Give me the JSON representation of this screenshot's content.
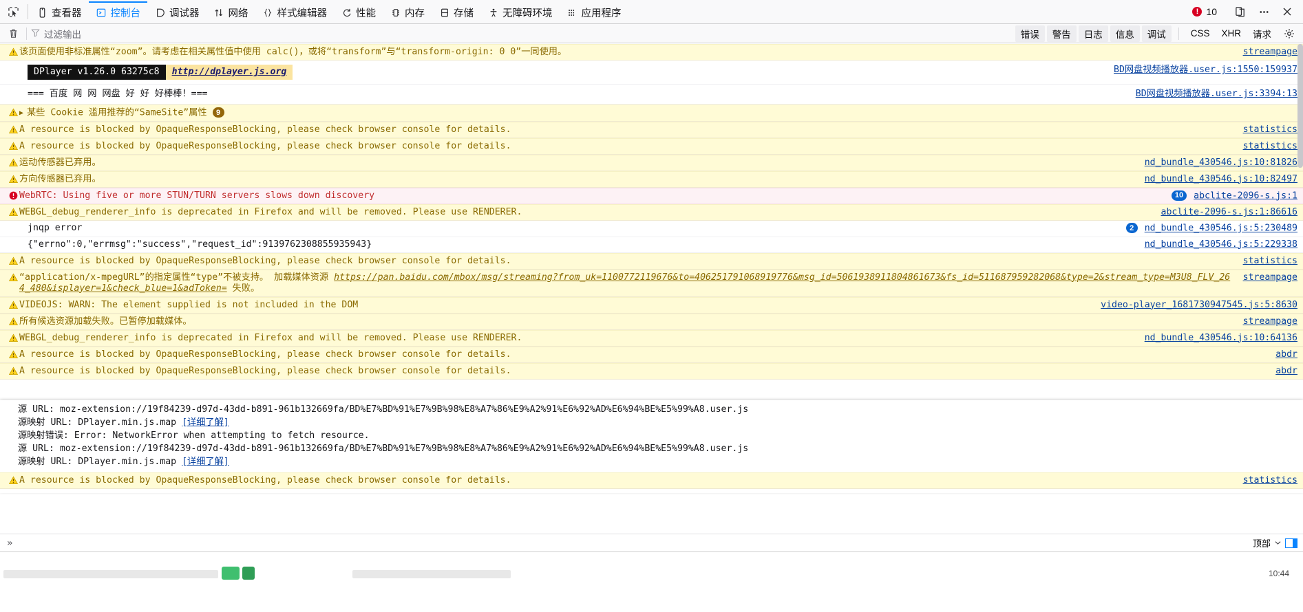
{
  "toolbar": {
    "picker_icon": "element-picker-icon",
    "tabs": [
      {
        "label": "查看器",
        "icon": "inspector-icon",
        "active": false
      },
      {
        "label": "控制台",
        "icon": "console-icon",
        "active": true
      },
      {
        "label": "调试器",
        "icon": "debugger-icon",
        "active": false
      },
      {
        "label": "网络",
        "icon": "network-icon",
        "active": false
      },
      {
        "label": "样式编辑器",
        "icon": "style-editor-icon",
        "active": false
      },
      {
        "label": "性能",
        "icon": "performance-icon",
        "active": false
      },
      {
        "label": "内存",
        "icon": "memory-icon",
        "active": false
      },
      {
        "label": "存储",
        "icon": "storage-icon",
        "active": false
      },
      {
        "label": "无障碍环境",
        "icon": "accessibility-icon",
        "active": false
      },
      {
        "label": "应用程序",
        "icon": "application-icon",
        "active": false
      }
    ],
    "error_count": "10",
    "responsive_icon": "responsive-design-mode-icon",
    "meatball_icon": "more-options-icon",
    "close_icon": "close-icon"
  },
  "filter_bar": {
    "trash_icon": "trash-icon",
    "funnel_icon": "funnel-icon",
    "filter_placeholder": "过滤输出",
    "filter_value": "",
    "levels": [
      "错误",
      "警告",
      "日志",
      "信息",
      "调试"
    ],
    "filters": [
      "CSS",
      "XHR",
      "请求"
    ],
    "settings_icon": "gear-icon"
  },
  "console": {
    "rows": [
      {
        "type": "warn",
        "text": "该页面使用非标准属性“zoom”。请考虑在相关属性值中使用 calc()，或将“transform”与“transform-origin: 0 0”一同使用。",
        "source": "streampage"
      },
      {
        "type": "dplayer",
        "badge_dark": "DPlayer v1.26.0 63275c8",
        "badge_link": "http://dplayer.js.org",
        "source": "BD网盘视频播放器.user.js:1550:159937"
      },
      {
        "type": "log",
        "text": "=== 百度 网 网 网盘 好 好 好棒棒！===",
        "source": "BD网盘视频播放器.user.js:3394:13"
      },
      {
        "type": "warn",
        "expandable": true,
        "text": "某些 Cookie 滥用推荐的“SameSite”属性",
        "badge": "9",
        "badge_style": "warn",
        "source": ""
      },
      {
        "type": "warn",
        "text": "A resource is blocked by OpaqueResponseBlocking, please check browser console for details.",
        "source": "statistics"
      },
      {
        "type": "warn",
        "text": "A resource is blocked by OpaqueResponseBlocking, please check browser console for details.",
        "source": "statistics"
      },
      {
        "type": "warn",
        "text": "运动传感器已弃用。",
        "source": "nd_bundle_430546.js:10:81826"
      },
      {
        "type": "warn",
        "text": "方向传感器已弃用。",
        "source": "nd_bundle_430546.js:10:82497"
      },
      {
        "type": "error",
        "text": "WebRTC: Using five or more STUN/TURN servers slows down discovery",
        "badge": "10",
        "badge_style": "blue",
        "source": "abclite-2096-s.js:1"
      },
      {
        "type": "warn",
        "text": "WEBGL_debug_renderer_info is deprecated in Firefox and will be removed. Please use RENDERER.",
        "source": "abclite-2096-s.js:1:86616"
      },
      {
        "type": "plain",
        "text": "jnqp error",
        "badge": "2",
        "badge_style": "blue",
        "source": "nd_bundle_430546.js:5:230489"
      },
      {
        "type": "plain",
        "text": "{\"errno\":0,\"errmsg\":\"success\",\"request_id\":9139762308855935943}",
        "source": "nd_bundle_430546.js:5:229338"
      },
      {
        "type": "warn",
        "text": "A resource is blocked by OpaqueResponseBlocking, please check browser console for details.",
        "source": "statistics"
      },
      {
        "type": "warn-link",
        "prefix": "“application/x-mpegURL”的指定属性“type”不被支持。 加载媒体资源 ",
        "link": "https://pan.baidu.com/mbox/msg/streaming?from_uk=1100772119676&to=406251791068919776&msg_id=5061938911804861673&fs_id=51168795928206​8&type=2&stream_type=M3U8_FLV_264_480&isplayer=1&check_blue=1&adToken=",
        "suffix": " 失败。",
        "source": "streampage"
      },
      {
        "type": "warn",
        "text": "VIDEOJS: WARN: The element supplied is not included in the DOM",
        "source": "video-player_1681730947545.js:5:8630"
      },
      {
        "type": "warn",
        "text": "所有候选资源加载失败。已暂停加载媒体。",
        "source": "streampage"
      },
      {
        "type": "warn",
        "text": "WEBGL_debug_renderer_info is deprecated in Firefox and will be removed. Please use RENDERER.",
        "source": "nd_bundle_430546.js:10:64136"
      },
      {
        "type": "warn",
        "text": "A resource is blocked by OpaqueResponseBlocking, please check browser console for details.",
        "source": "abdr"
      },
      {
        "type": "warn",
        "text": "A resource is blocked by OpaqueResponseBlocking, please check browser console for details.",
        "source": "abdr"
      }
    ],
    "sourcemap_panel": {
      "lines": [
        {
          "text": "源 URL: moz-extension://19f84239-d97d-43dd-b891-961b132669fa/BD%E7%BD%91%E7%9B%98%E8%A7%86%E9%A2%91%E6%92%AD%E6%94%BE%E5%99%A8.user.js",
          "link": ""
        },
        {
          "text": "源映射 URL: DPlayer.min.js.map",
          "link": "[详细了解]"
        },
        {
          "text": "源映射错误: Error: NetworkError when attempting to fetch resource.",
          "link": ""
        },
        {
          "text": "源 URL: moz-extension://19f84239-d97d-43dd-b891-961b132669fa/BD%E7%BD%91%E7%9B%98%E8%A7%86%E9%A2%91%E6%92%AD%E6%94%BE%E5%99%A8.user.js",
          "link": ""
        },
        {
          "text": "源映射 URL: DPlayer.min.js.map",
          "link": "[详细了解]"
        }
      ]
    },
    "last_row": {
      "type": "warn",
      "text": "A resource is blocked by OpaqueResponseBlocking, please check browser console for details.",
      "source": "statistics"
    }
  },
  "prompt": {
    "chevron": "»",
    "value": "",
    "context_label": "顶部",
    "context_chevron": "chevron-down-icon",
    "split_icon": "split-console-icon"
  },
  "page_below": {
    "time": "10:44"
  },
  "colors": {
    "accent": "#0a84ff",
    "warn_bg": "#fffbd6",
    "error_bg": "#fdf2f5",
    "link": "#0842a0",
    "error_red": "#d70022"
  }
}
